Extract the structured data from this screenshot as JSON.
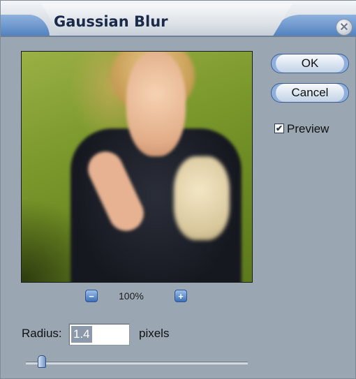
{
  "dialog": {
    "title": "Gaussian Blur",
    "close_icon": "close-icon"
  },
  "preview": {
    "zoom_level": "100%",
    "zoom_out_icon": "minus-icon",
    "zoom_in_icon": "plus-icon"
  },
  "buttons": {
    "ok_label": "OK",
    "cancel_label": "Cancel"
  },
  "preview_toggle": {
    "label": "Preview",
    "checked": true
  },
  "radius": {
    "label": "Radius:",
    "value": "1.4",
    "unit": "pixels"
  },
  "colors": {
    "dialog_bg": "#9aa7b3",
    "title_accent": "#4f7fbf",
    "title_text": "#1a2a4a"
  }
}
